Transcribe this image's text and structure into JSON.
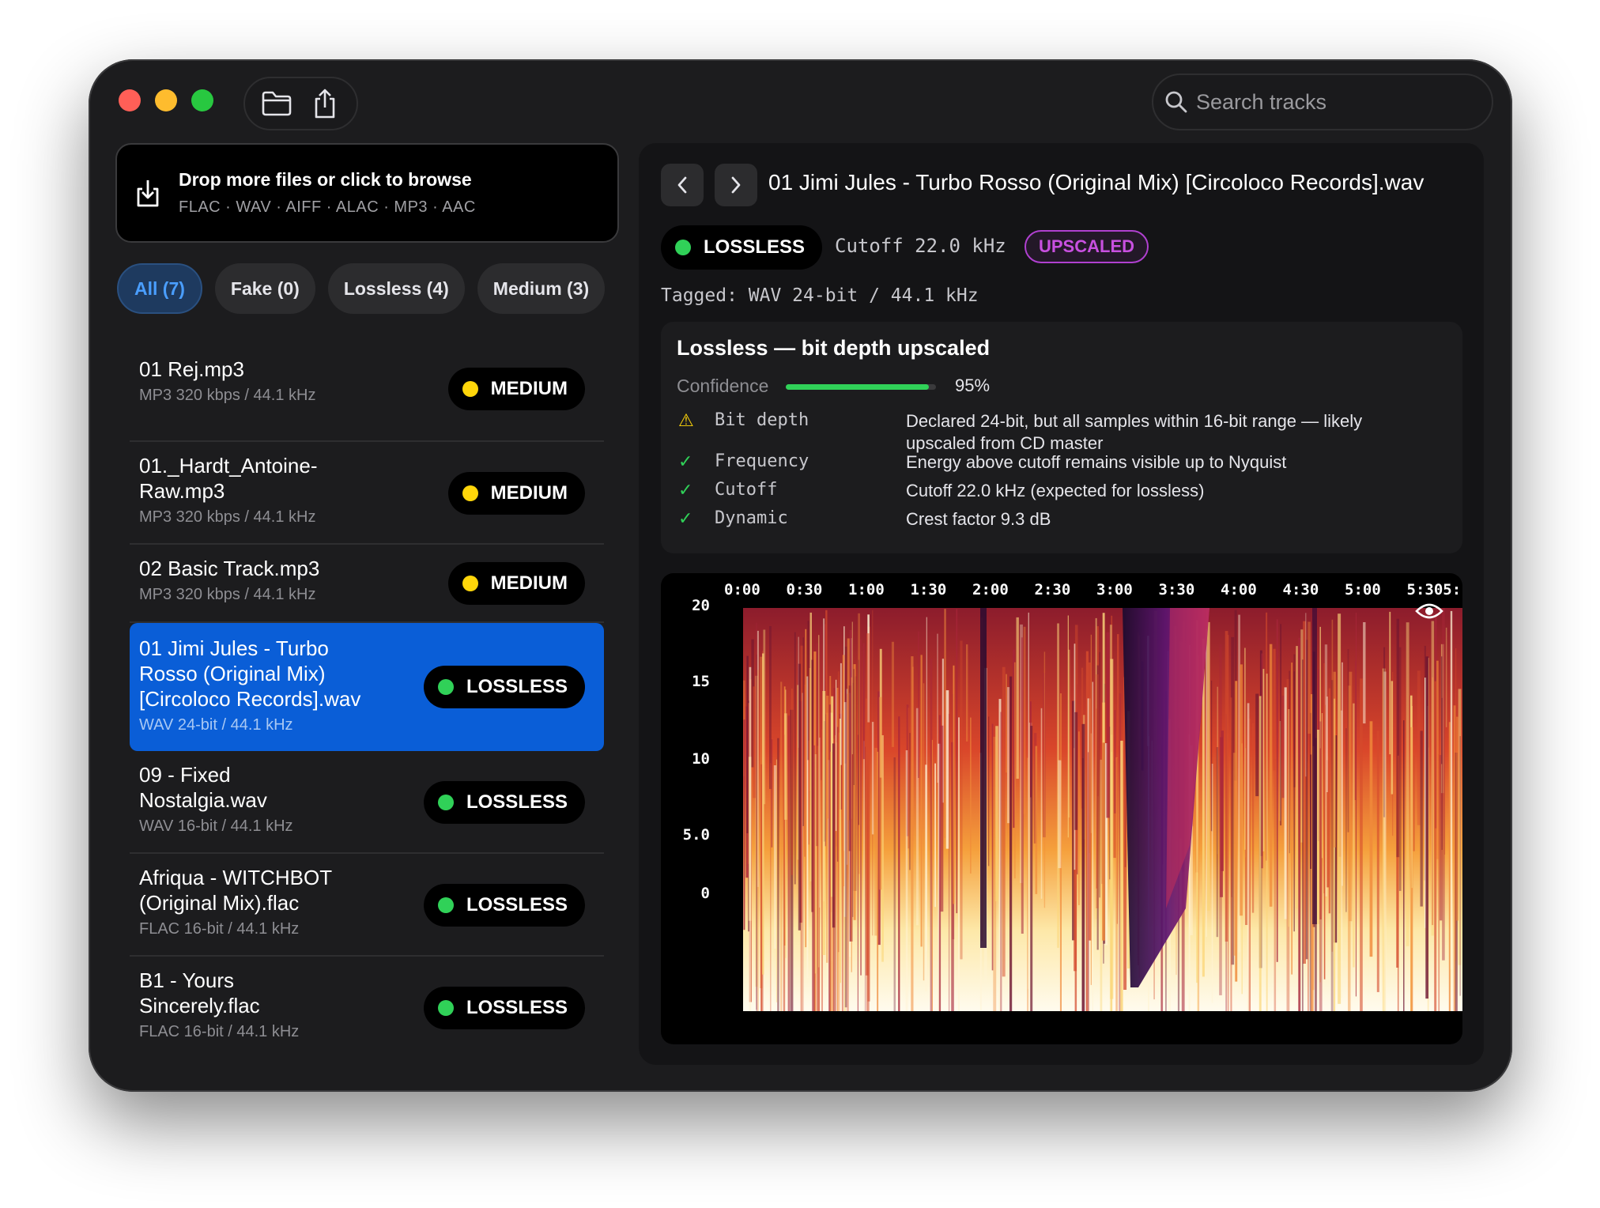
{
  "toolbar": {
    "open_icon": "folder-icon",
    "share_icon": "share-icon"
  },
  "search": {
    "placeholder": "Search tracks"
  },
  "dropzone": {
    "title": "Drop more files or click to browse",
    "formats": "FLAC · WAV · AIFF · ALAC · MP3 · AAC"
  },
  "filters": [
    {
      "label": "All (7)",
      "active": true
    },
    {
      "label": "Fake (0)"
    },
    {
      "label": "Lossless (4)"
    },
    {
      "label": "Medium (3)"
    }
  ],
  "tracks": [
    {
      "name": "01 Rej.mp3",
      "meta": "MP3 320 kbps / 44.1 kHz",
      "verdict": "MEDIUM",
      "color": "#ffd60a"
    },
    {
      "name": "01._Hardt_Antoine-\nRaw.mp3",
      "meta": "MP3 320 kbps / 44.1 kHz",
      "verdict": "MEDIUM",
      "color": "#ffd60a"
    },
    {
      "name": "02 Basic Track.mp3",
      "meta": "MP3 320 kbps / 44.1 kHz",
      "verdict": "MEDIUM",
      "color": "#ffd60a"
    },
    {
      "name": "01 Jimi Jules - Turbo\nRosso (Original Mix)\n[Circoloco Records].wav",
      "meta": "WAV 24-bit / 44.1 kHz",
      "verdict": "LOSSLESS",
      "color": "#30d158",
      "selected": true
    },
    {
      "name": "09 - Fixed\nNostalgia.wav",
      "meta": "WAV 16-bit / 44.1 kHz",
      "verdict": "LOSSLESS",
      "color": "#30d158"
    },
    {
      "name": "Afriqua - WITCHBOT\n(Original Mix).flac",
      "meta": "FLAC 16-bit / 44.1 kHz",
      "verdict": "LOSSLESS",
      "color": "#30d158"
    },
    {
      "name": "B1  - Yours\nSincerely.flac",
      "meta": "FLAC 16-bit / 44.1 kHz",
      "verdict": "LOSSLESS",
      "color": "#30d158"
    }
  ],
  "detail": {
    "file_title": "01 Jimi Jules - Turbo Rosso (Original Mix) [Circoloco Records].wav",
    "verdict": "LOSSLESS",
    "cutoff": "Cutoff 22.0 kHz",
    "tag": "UPSCALED",
    "tagged": "Tagged: WAV 24-bit / 44.1 kHz",
    "analysis": {
      "title": "Lossless — bit depth upscaled",
      "confidence_label": "Confidence",
      "confidence_value": "95%",
      "confidence_fraction": 0.95,
      "checks": [
        {
          "icon": "warning-icon",
          "symbol": "⚠",
          "status_color": "#ffd60a",
          "name": "Bit depth",
          "desc": "Declared 24-bit, but all samples within 16-bit range — likely upscaled from CD master"
        },
        {
          "icon": "check-icon",
          "symbol": "✓",
          "status_color": "#30d158",
          "name": "Frequency",
          "desc": "Energy above cutoff remains visible up to Nyquist"
        },
        {
          "icon": "check-icon",
          "symbol": "✓",
          "status_color": "#30d158",
          "name": "Cutoff",
          "desc": "Cutoff 22.0 kHz (expected for lossless)"
        },
        {
          "icon": "check-icon",
          "symbol": "✓",
          "status_color": "#30d158",
          "name": "Dynamic",
          "desc": "Crest factor 9.3 dB"
        }
      ]
    },
    "spectrogram": {
      "x_ticks": [
        "0:00",
        "0:30",
        "1:00",
        "1:30",
        "2:00",
        "2:30",
        "3:00",
        "3:30",
        "4:00",
        "4:30",
        "5:00",
        "5:305:"
      ],
      "y_ticks": [
        "20",
        "15",
        "10",
        "5.0",
        "0"
      ],
      "eye_icon": "eye-icon"
    }
  }
}
